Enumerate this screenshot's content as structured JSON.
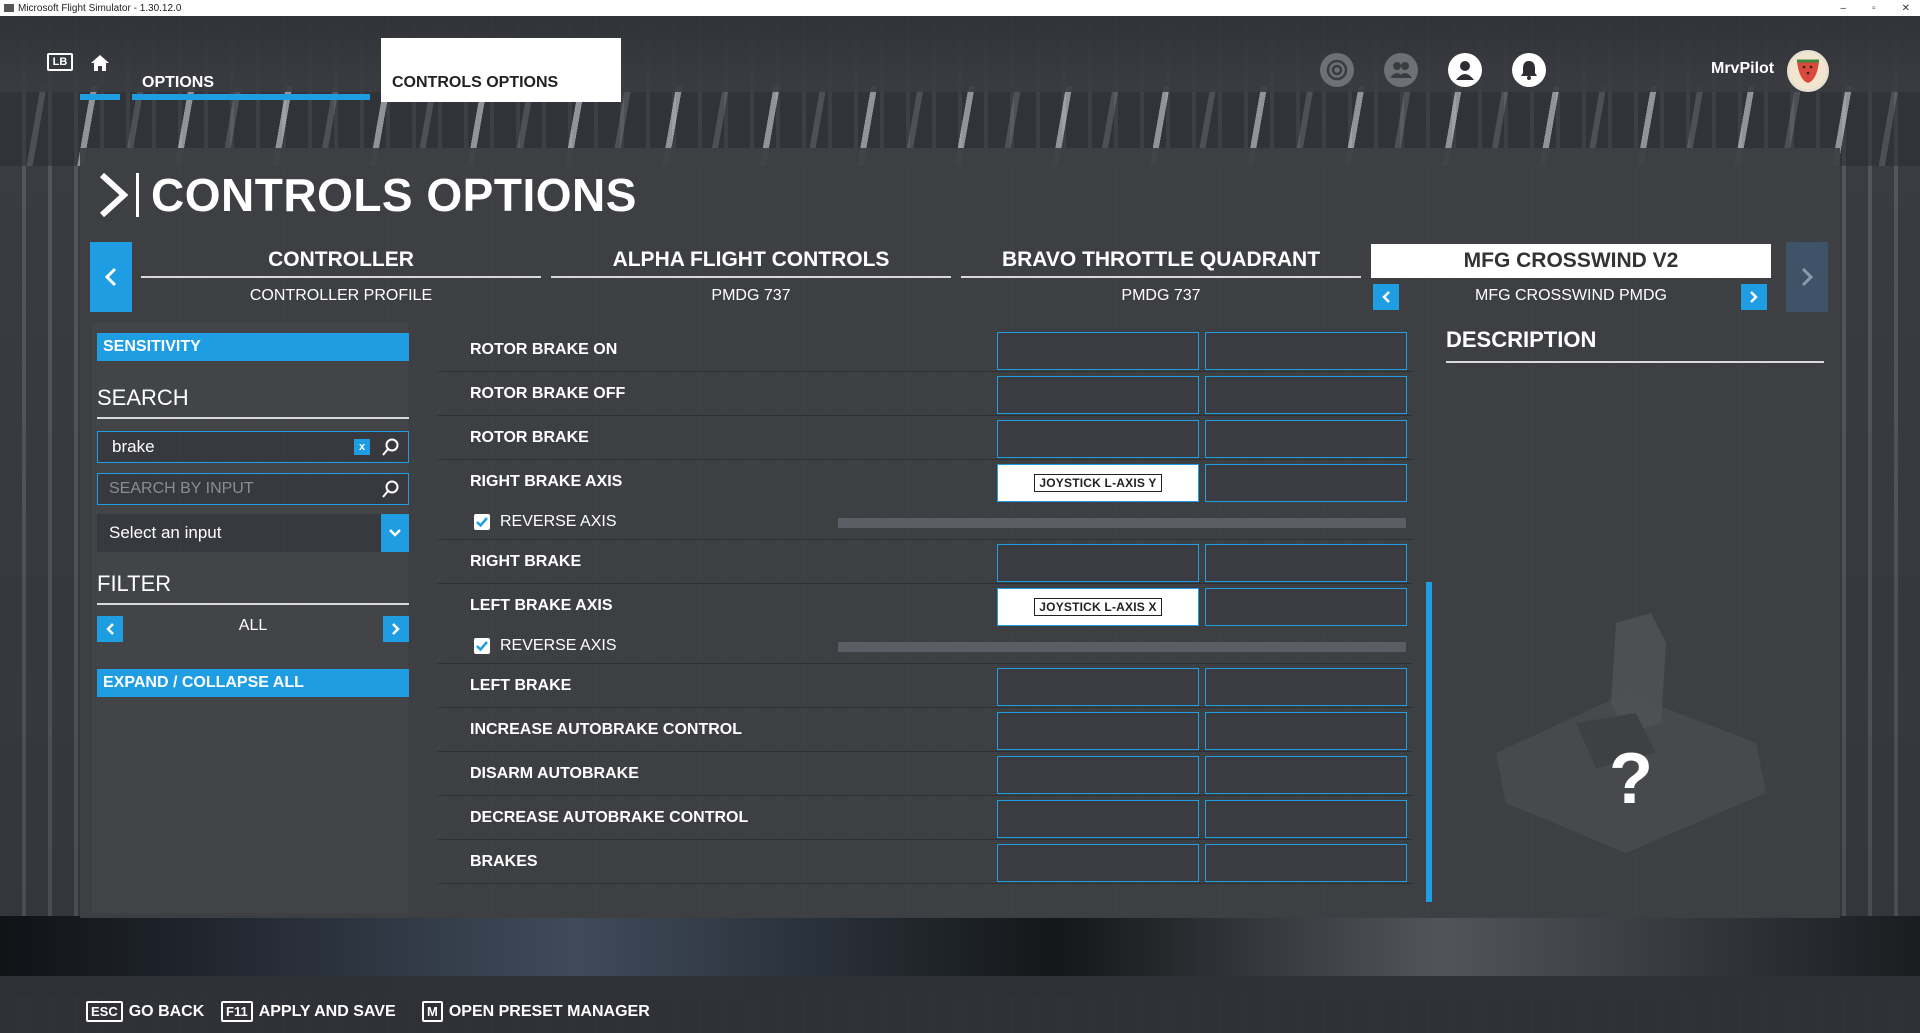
{
  "window": {
    "title": "Microsoft Flight Simulator - 1.30.12.0",
    "controls": [
      "–",
      "▫",
      "✕"
    ]
  },
  "topnav": {
    "lb_key": "LB",
    "options_label": "OPTIONS",
    "controls_tab_label": "CONTROLS OPTIONS",
    "username": "MrvPilot",
    "icons": [
      "achievements-icon",
      "friends-icon",
      "profile-icon",
      "notifications-icon"
    ]
  },
  "page": {
    "title": "CONTROLS OPTIONS"
  },
  "devices": [
    {
      "name": "CONTROLLER",
      "profile": "CONTROLLER PROFILE",
      "active": false
    },
    {
      "name": "ALPHA FLIGHT CONTROLS",
      "profile": "PMDG 737",
      "active": false
    },
    {
      "name": "BRAVO THROTTLE QUADRANT",
      "profile": "PMDG 737",
      "active": false
    },
    {
      "name": "MFG CROSSWIND V2",
      "profile": "MFG CROSSWIND PMDG",
      "active": true
    }
  ],
  "sidebar": {
    "sensitivity_label": "SENSITIVITY",
    "search_heading": "SEARCH",
    "search_value": "brake",
    "clear_label": "x",
    "search_by_input_placeholder": "SEARCH BY INPUT",
    "select_input_label": "Select an input",
    "filter_heading": "FILTER",
    "filter_value": "ALL",
    "expand_label": "EXPAND / COLLAPSE ALL"
  },
  "bindings": [
    {
      "label": "ROTOR BRAKE ON",
      "input1": "",
      "input2": ""
    },
    {
      "label": "ROTOR BRAKE OFF",
      "input1": "",
      "input2": ""
    },
    {
      "label": "ROTOR BRAKE",
      "input1": "",
      "input2": ""
    },
    {
      "label": "RIGHT BRAKE AXIS",
      "input1": "JOYSTICK L-AXIS Y",
      "input2": "",
      "reverse_axis": true,
      "reverse_label": "REVERSE AXIS"
    },
    {
      "label": "RIGHT BRAKE",
      "input1": "",
      "input2": ""
    },
    {
      "label": "LEFT BRAKE AXIS",
      "input1": "JOYSTICK L-AXIS X",
      "input2": "",
      "reverse_axis": true,
      "reverse_label": "REVERSE AXIS"
    },
    {
      "label": "LEFT BRAKE",
      "input1": "",
      "input2": ""
    },
    {
      "label": "INCREASE AUTOBRAKE CONTROL",
      "input1": "",
      "input2": ""
    },
    {
      "label": "DISARM AUTOBRAKE",
      "input1": "",
      "input2": ""
    },
    {
      "label": "DECREASE AUTOBRAKE CONTROL",
      "input1": "",
      "input2": ""
    },
    {
      "label": "BRAKES",
      "input1": "",
      "input2": ""
    }
  ],
  "description": {
    "title": "DESCRIPTION",
    "placeholder_glyph": "?"
  },
  "footer": [
    {
      "key": "ESC",
      "label": "GO BACK"
    },
    {
      "key": "F11",
      "label": "APPLY AND SAVE"
    },
    {
      "key": "M",
      "label": "OPEN PRESET MANAGER"
    }
  ],
  "colors": {
    "accent": "#1e9de3",
    "panel": "#3e4044",
    "active_tab": "#ffffff"
  }
}
